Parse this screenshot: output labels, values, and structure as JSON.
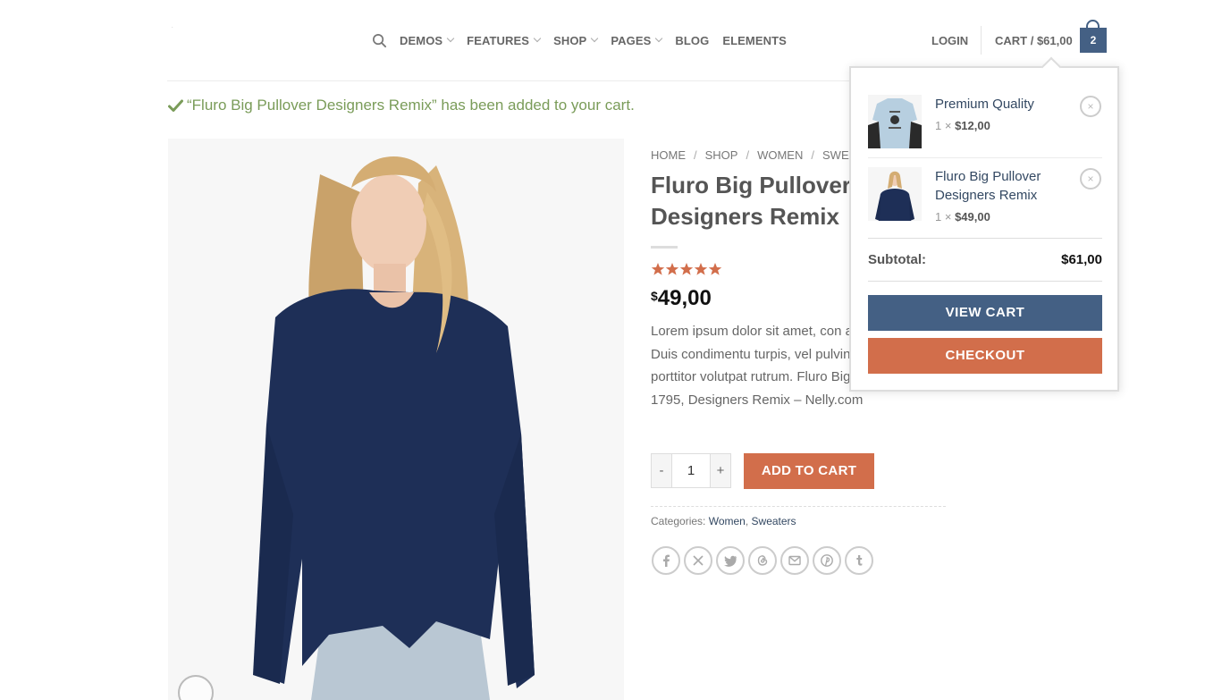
{
  "header": {
    "logo_text": "·",
    "nav": [
      {
        "label": "DEMOS",
        "dropdown": true
      },
      {
        "label": "FEATURES",
        "dropdown": true
      },
      {
        "label": "SHOP",
        "dropdown": true
      },
      {
        "label": "PAGES",
        "dropdown": true
      },
      {
        "label": "BLOG",
        "dropdown": false
      },
      {
        "label": "ELEMENTS",
        "dropdown": false
      }
    ],
    "login_label": "LOGIN",
    "cart_label": "CART / $61,00",
    "cart_count": "2"
  },
  "notice": {
    "text": "“Fluro Big Pullover Designers Remix” has been added to your cart."
  },
  "breadcrumb": [
    "HOME",
    "SHOP",
    "WOMEN",
    "SWEA"
  ],
  "product": {
    "title": "Fluro Big Pullover Designers Remix",
    "rating": 5,
    "price_currency": "$",
    "price_amount": "49,00",
    "description": "Lorem ipsum dolor sit amet, con adipiscing elit. Duis condimentu turpis, vel pulvinar diam vulputa porttitor volutpat rutrum. Fluro Big Pullover NOK 1795, Designers Remix – Nelly.com",
    "quantity": "1",
    "qty_minus": "-",
    "qty_plus": "+",
    "add_to_cart_label": "ADD TO CART",
    "categories_label": "Categories:",
    "categories": [
      "Women",
      "Sweaters"
    ]
  },
  "share_icons": [
    "facebook-icon",
    "x-icon",
    "twitter-icon",
    "threads-icon",
    "email-icon",
    "pinterest-icon",
    "tumblr-icon"
  ],
  "mini_cart": {
    "items": [
      {
        "name": "Premium Quality",
        "qty": "1 ×",
        "price": "$12,00"
      },
      {
        "name": "Fluro Big Pullover Designers Remix",
        "qty": "1 ×",
        "price": "$49,00"
      }
    ],
    "remove_symbol": "×",
    "subtotal_label": "Subtotal:",
    "subtotal_value": "$61,00",
    "view_cart_label": "VIEW CART",
    "checkout_label": "CHECKOUT"
  },
  "colors": {
    "primary": "#446084",
    "secondary": "#d26e4b",
    "success": "#7a9c59",
    "link": "#334862",
    "star": "#d26e4b"
  }
}
